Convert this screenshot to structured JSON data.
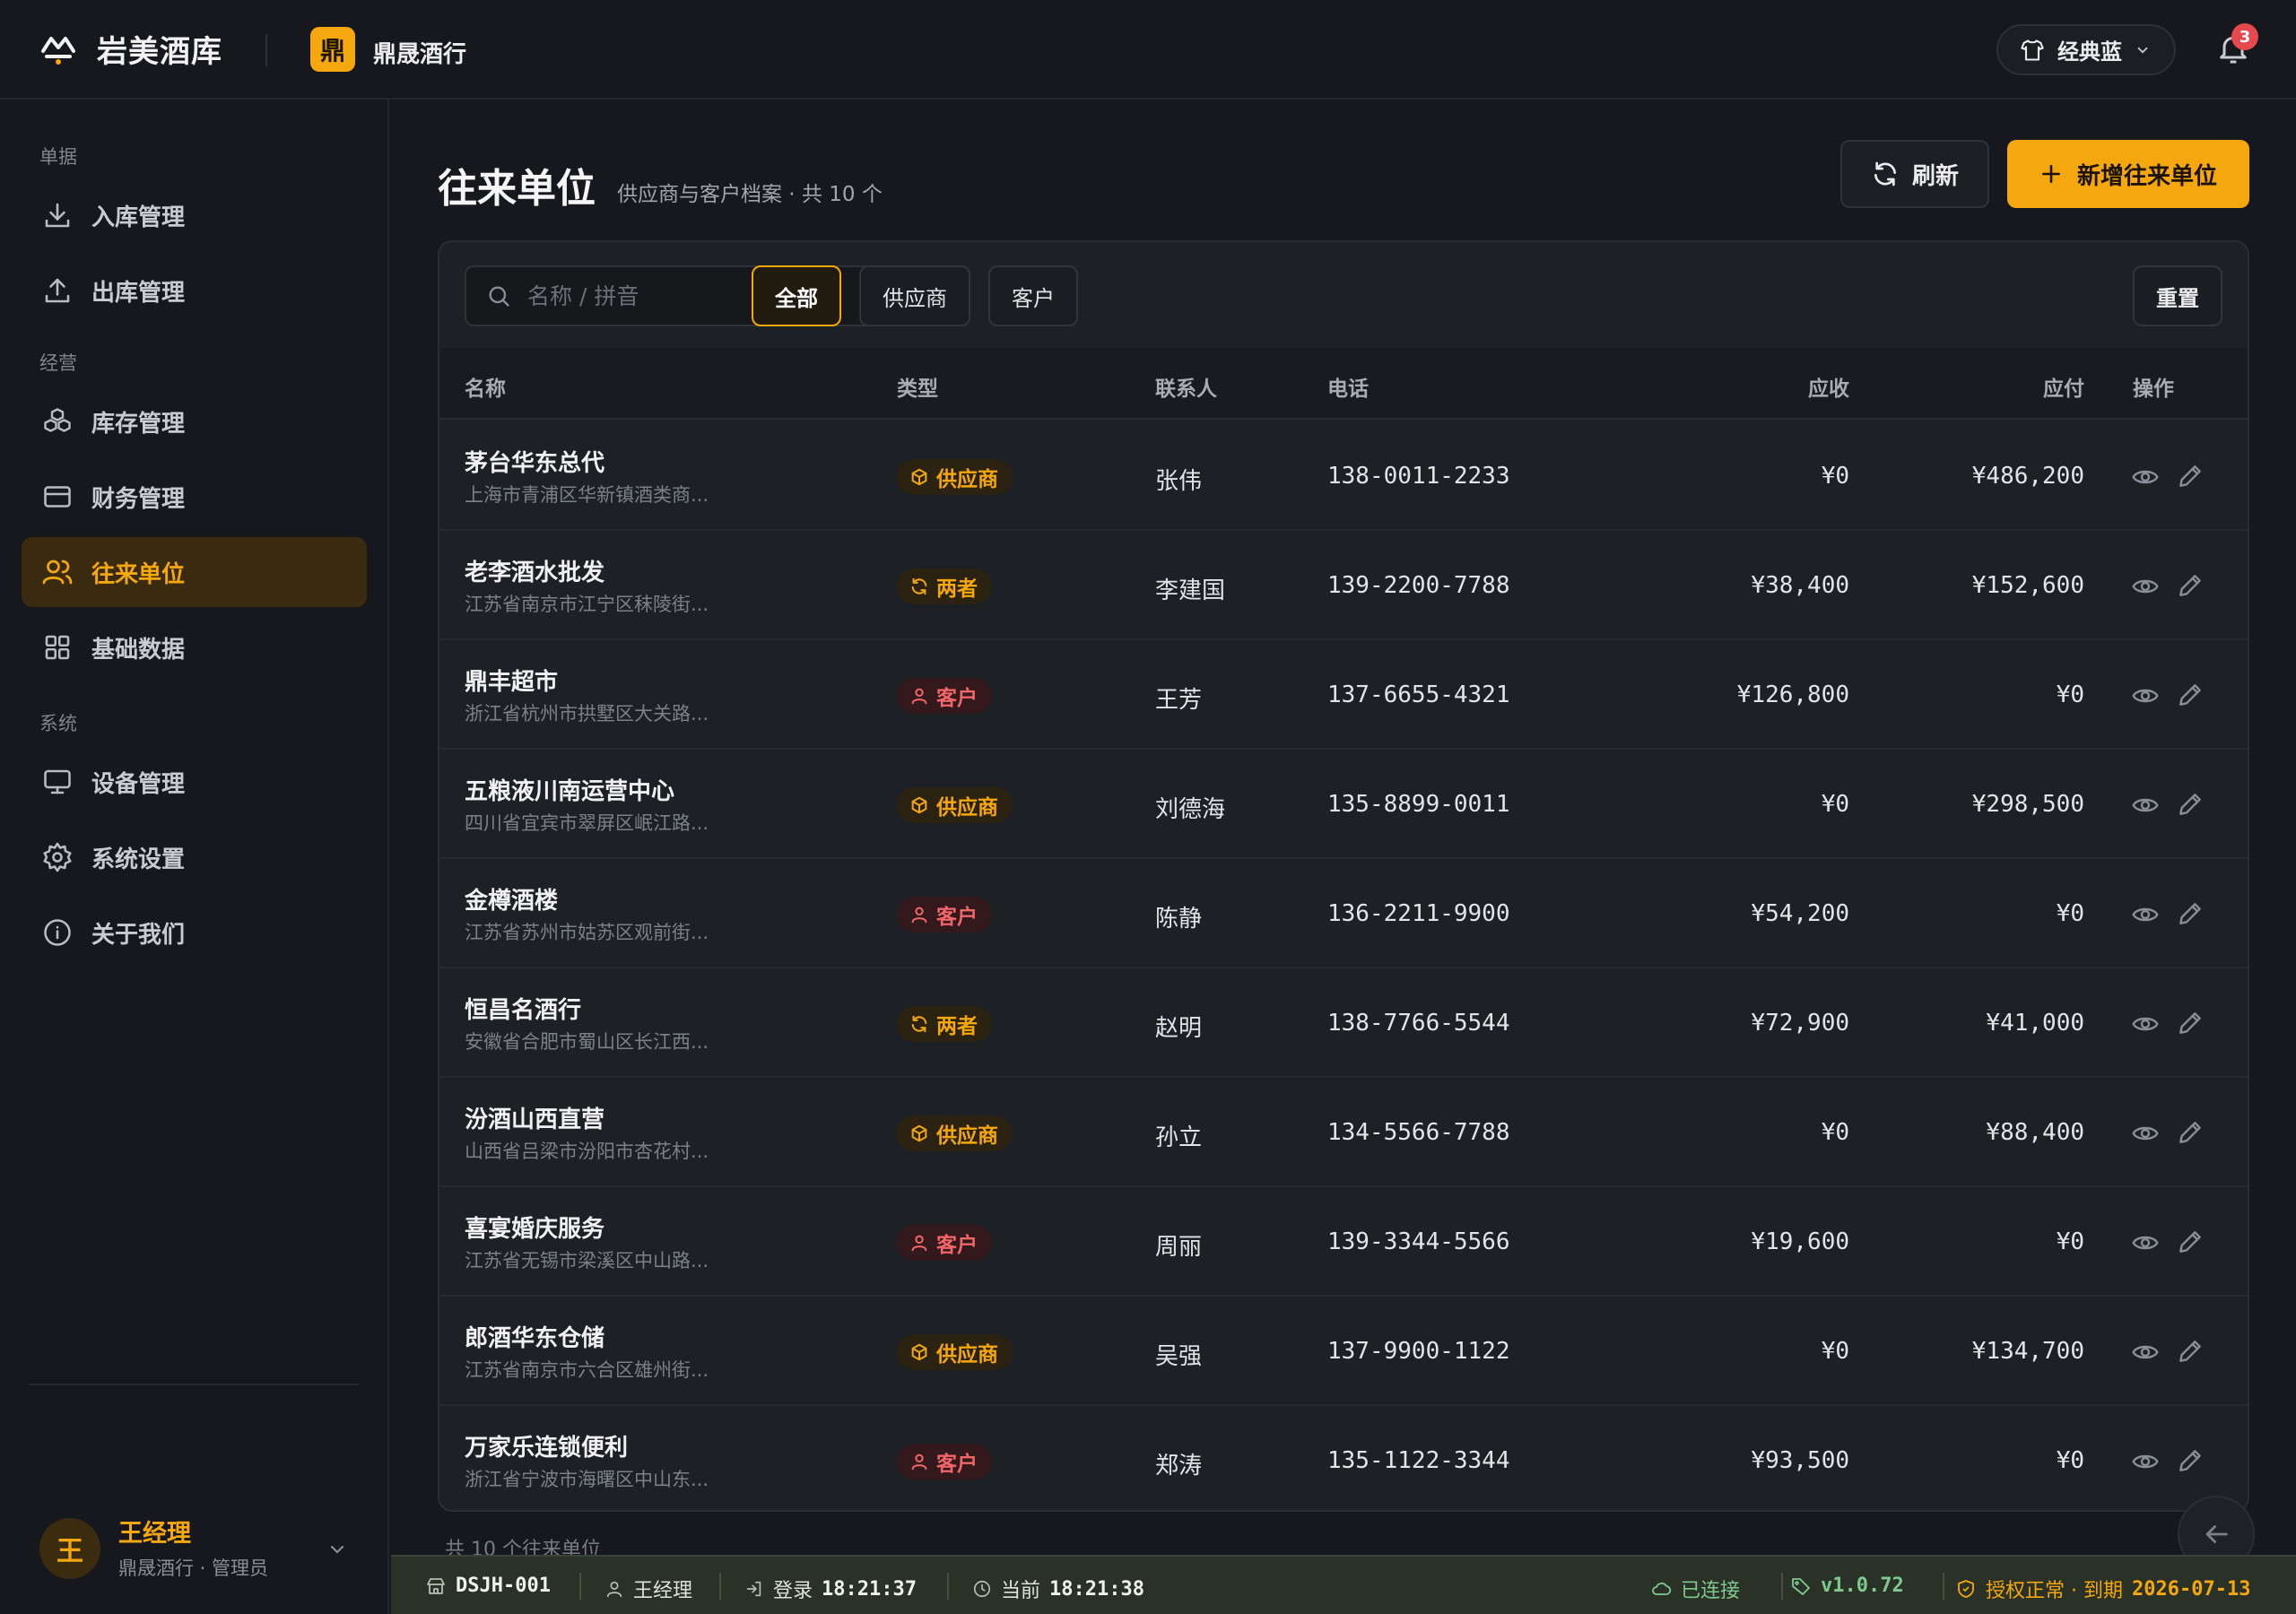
{
  "app": {
    "title": "岩美酒库",
    "store_badge": "鼎",
    "store_name": "鼎晟酒行",
    "theme_label": "经典蓝",
    "notification_count": "3"
  },
  "sidebar": {
    "sections": [
      {
        "label": "单据"
      },
      {
        "label": "经营"
      },
      {
        "label": "系统"
      }
    ],
    "items": [
      {
        "label": "入库管理",
        "icon": "download-icon"
      },
      {
        "label": "出库管理",
        "icon": "upload-icon"
      },
      {
        "label": "库存管理",
        "icon": "boxes-icon"
      },
      {
        "label": "财务管理",
        "icon": "credit-card-icon"
      },
      {
        "label": "往来单位",
        "icon": "users-icon",
        "active": true
      },
      {
        "label": "基础数据",
        "icon": "grid-icon"
      },
      {
        "label": "设备管理",
        "icon": "monitor-icon"
      },
      {
        "label": "系统设置",
        "icon": "gear-icon"
      },
      {
        "label": "关于我们",
        "icon": "info-icon"
      }
    ],
    "user": {
      "avatar": "王",
      "name": "王经理",
      "role": "鼎晟酒行 · 管理员"
    }
  },
  "main": {
    "title": "往来单位",
    "subtitle": "供应商与客户档案 · 共 10 个",
    "refresh_label": "刷新",
    "add_label": "新增往来单位",
    "search_placeholder": "名称 / 拼音",
    "filters": [
      {
        "label": "全部",
        "active": true
      },
      {
        "label": "供应商"
      },
      {
        "label": "客户"
      }
    ],
    "reset_label": "重置",
    "columns": {
      "name": "名称",
      "type": "类型",
      "contact": "联系人",
      "phone": "电话",
      "receivable": "应收",
      "payable": "应付",
      "actions": "操作"
    },
    "rows": [
      {
        "name": "茅台华东总代",
        "address": "上海市青浦区华新镇酒类商...",
        "type": "供应商",
        "kind": "supplier",
        "contact": "张伟",
        "phone": "138-0011-2233",
        "receivable": "¥0",
        "payable": "¥486,200"
      },
      {
        "name": "老李酒水批发",
        "address": "江苏省南京市江宁区秣陵街...",
        "type": "两者",
        "kind": "both",
        "contact": "李建国",
        "phone": "139-2200-7788",
        "receivable": "¥38,400",
        "payable": "¥152,600"
      },
      {
        "name": "鼎丰超市",
        "address": "浙江省杭州市拱墅区大关路...",
        "type": "客户",
        "kind": "customer",
        "contact": "王芳",
        "phone": "137-6655-4321",
        "receivable": "¥126,800",
        "payable": "¥0"
      },
      {
        "name": "五粮液川南运营中心",
        "address": "四川省宜宾市翠屏区岷江路...",
        "type": "供应商",
        "kind": "supplier",
        "contact": "刘德海",
        "phone": "135-8899-0011",
        "receivable": "¥0",
        "payable": "¥298,500"
      },
      {
        "name": "金樽酒楼",
        "address": "江苏省苏州市姑苏区观前街...",
        "type": "客户",
        "kind": "customer",
        "contact": "陈静",
        "phone": "136-2211-9900",
        "receivable": "¥54,200",
        "payable": "¥0"
      },
      {
        "name": "恒昌名酒行",
        "address": "安徽省合肥市蜀山区长江西...",
        "type": "两者",
        "kind": "both",
        "contact": "赵明",
        "phone": "138-7766-5544",
        "receivable": "¥72,900",
        "payable": "¥41,000"
      },
      {
        "name": "汾酒山西直营",
        "address": "山西省吕梁市汾阳市杏花村...",
        "type": "供应商",
        "kind": "supplier",
        "contact": "孙立",
        "phone": "134-5566-7788",
        "receivable": "¥0",
        "payable": "¥88,400"
      },
      {
        "name": "喜宴婚庆服务",
        "address": "江苏省无锡市梁溪区中山路...",
        "type": "客户",
        "kind": "customer",
        "contact": "周丽",
        "phone": "139-3344-5566",
        "receivable": "¥19,600",
        "payable": "¥0"
      },
      {
        "name": "郎酒华东仓储",
        "address": "江苏省南京市六合区雄州街...",
        "type": "供应商",
        "kind": "supplier",
        "contact": "吴强",
        "phone": "137-9900-1122",
        "receivable": "¥0",
        "payable": "¥134,700"
      },
      {
        "name": "万家乐连锁便利",
        "address": "浙江省宁波市海曙区中山东...",
        "type": "客户",
        "kind": "customer",
        "contact": "郑涛",
        "phone": "135-1122-3344",
        "receivable": "¥93,500",
        "payable": "¥0"
      }
    ],
    "footer_text": "共 10 个往来单位"
  },
  "statusbar": {
    "device_id": "DSJH-001",
    "user": "王经理",
    "login_label": "登录",
    "login_time": "18:21:37",
    "current_label": "当前",
    "current_time": "18:21:38",
    "connection": "已连接",
    "version": "v1.0.72",
    "license_label": "授权正常 · 到期",
    "license_expiry": "2026-07-13"
  },
  "colors": {
    "accent": "#f4a70e",
    "customer": "#f1666a",
    "background": "#16181d",
    "statusbar": "#2a3227",
    "connected": "#7fc98f"
  }
}
